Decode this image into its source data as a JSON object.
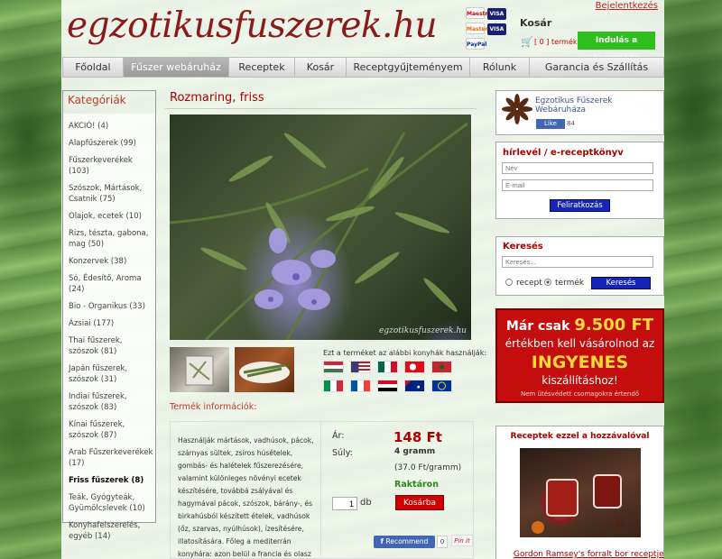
{
  "header": {
    "logo": "egzotikusfuszerek.hu",
    "login": "Bejelentkezés",
    "cart_title": "Kosár",
    "cart_count": "[ 0 ] termék",
    "checkout": "Indulás a kasszához",
    "payment_cards": [
      "Maestro",
      "VISA",
      "MasterCard",
      "VISA",
      "PayPal"
    ]
  },
  "nav": [
    "Főoldal",
    "Fűszer webáruház",
    "Receptek",
    "Kosár",
    "Receptgyűjteményem",
    "Rólunk",
    "Garancia és Szállítás"
  ],
  "nav_active": 1,
  "categories": {
    "title": "Kategóriák",
    "items": [
      "AKCIÓ! (4)",
      "Alapfűszerek (99)",
      "Fűszerkeverékek (103)",
      "Szószok, Mártások, Csatnik (75)",
      "Olajok, ecetek (10)",
      "Rizs, tészta, gabona, mag (50)",
      "Konzervek (38)",
      "Só, Édesítő, Aroma (24)",
      "Bio - Organikus (33)",
      "Ázsiai (177)",
      "Thai fűszerek, szószok (81)",
      "Japán fűszerek, szószok (31)",
      "Indiai fűszerek, szószok (83)",
      "Kínai fűszerek, szószok (87)",
      "Arab Fűszerkeverékek (17)",
      "Friss fűszerek (8)",
      "Teák, Gyógyteák, Gyümölcslevek (10)",
      "Konyhafelszerelés, egyéb (14)"
    ],
    "active": "Friss fűszerek (8)"
  },
  "product": {
    "title": "Rozmaring, friss",
    "watermark": "egzotikusfuszerek.hu",
    "flags_label": "Ezt a terméket az alábbi konyhák használják:",
    "flags": [
      {
        "name": "hungary",
        "colors": [
          "#ce2939",
          "#ffffff",
          "#477050"
        ]
      },
      {
        "name": "usa",
        "colors": [
          "#b22234",
          "#ffffff",
          "#3c3b6e"
        ]
      },
      {
        "name": "mexico",
        "colors": [
          "#006847",
          "#ffffff",
          "#ce1126"
        ]
      },
      {
        "name": "turkey",
        "colors": [
          "#e30a17",
          "#ffffff"
        ]
      },
      {
        "name": "morocco",
        "colors": [
          "#c1272d",
          "#006233"
        ]
      },
      {
        "name": "italy",
        "colors": [
          "#009246",
          "#ffffff",
          "#ce2b37"
        ]
      },
      {
        "name": "france",
        "colors": [
          "#0055a4",
          "#ffffff",
          "#ef4135"
        ]
      },
      {
        "name": "egypt",
        "colors": [
          "#ce1126",
          "#ffffff",
          "#000000"
        ]
      },
      {
        "name": "australia",
        "colors": [
          "#00247d",
          "#ffffff"
        ]
      },
      {
        "name": "eu",
        "colors": [
          "#003399",
          "#ffcc00"
        ]
      }
    ],
    "info_title": "Termék információk:",
    "description": "Használják mártások, vadhúsok, pácok, szárnyas sültek, zsíros húsételek, gombás- és halételek fűszerezésére, valamint különleges növényi ecetek készítésére, továbbá zsályával és hagymával pácok, szószok, bárány-, és birkahúsból készített ételek, vadhúsok (őz, szarvas, nyúlhúsok), ízesítésére, illatosítására. Főleg a mediterrán konyhára: azon belül a francia és olasz",
    "price_label": "Ár:",
    "price": "148 Ft",
    "weight_label": "Súly:",
    "weight": "4 gramm",
    "unit_price": "(37.0 Ft/gramm)",
    "stock": "Raktáron",
    "qty": "1",
    "qty_unit": "db",
    "buy": "Kosárba",
    "fb_recommend": "Recommend",
    "fb_count": "0",
    "pin": "Pin it"
  },
  "sidebar": {
    "fb_page": "Egzotikus Fűszerek Webáruháza",
    "fb_like": "Like",
    "fb_likes": "84",
    "newsletter": {
      "title": "hírlevél / e-receptkönyv",
      "name_ph": "Név",
      "email_ph": "E-mail",
      "button": "Feliratkozás"
    },
    "search": {
      "title": "Keresés",
      "placeholder": "Keresés...",
      "opt_recipe": "recept",
      "opt_product": "termék",
      "button": "Keresés"
    },
    "promo": {
      "line1": "Már csak",
      "amount": "9.500 FT",
      "line2": "értékben kell vásárolnod az",
      "big": "INGYENES",
      "line3": "kiszállításhoz!",
      "note": "Nem ütésvédett csomagokra értendő"
    },
    "recipes": {
      "title": "Receptek ezzel a hozzávalóval",
      "link": "Gordon Ramsey's forralt bor receptje"
    }
  }
}
